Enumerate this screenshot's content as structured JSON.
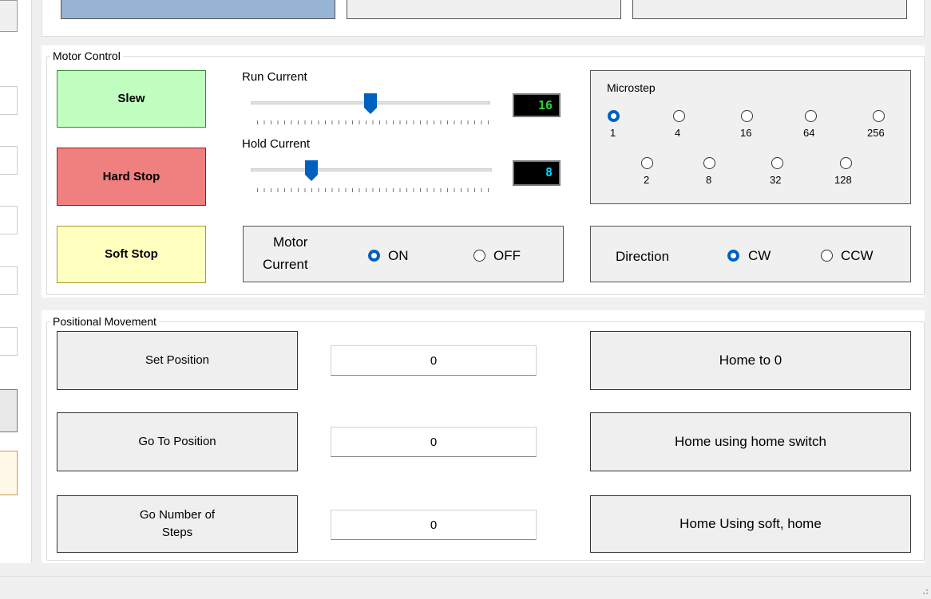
{
  "motor_control": {
    "label": "Motor Control",
    "slew": "Slew",
    "hard_stop": "Hard Stop",
    "soft_stop": "Soft Stop",
    "run_current": {
      "label": "Run Current",
      "value": "16",
      "level": 0.5,
      "color": "#2bd42b"
    },
    "hold_current": {
      "label": "Hold Current",
      "value": "8",
      "level": 0.25,
      "color": "#00d8ff"
    },
    "microstep": {
      "label": "Microstep",
      "options_row1": [
        "1",
        "4",
        "16",
        "64",
        "256"
      ],
      "options_row2": [
        "2",
        "8",
        "32",
        "128"
      ],
      "selected": "1"
    },
    "motor_current": {
      "label": "Motor Current",
      "label_line1": "Motor",
      "label_line2": "Current",
      "on": "ON",
      "off": "OFF",
      "selected": "ON"
    },
    "direction": {
      "label": "Direction",
      "cw": "CW",
      "ccw": "CCW",
      "selected": "CW"
    }
  },
  "positional_movement": {
    "label": "Positional Movement",
    "set_position": "Set Position",
    "go_to_position": "Go To Position",
    "go_number_line1": "Go Number of",
    "go_number_line2": "Steps",
    "set_position_value": "0",
    "go_to_position_value": "0",
    "go_number_value": "0",
    "home_to_0": "Home to 0",
    "home_switch": "Home using home switch",
    "home_soft": "Home Using soft, home"
  },
  "colors": {
    "slew": "#c0ffc0",
    "hard_stop": "#f08080",
    "soft_stop": "#ffffc0",
    "accent": "#0060c0",
    "top_tab_active": "#98b4d4"
  }
}
